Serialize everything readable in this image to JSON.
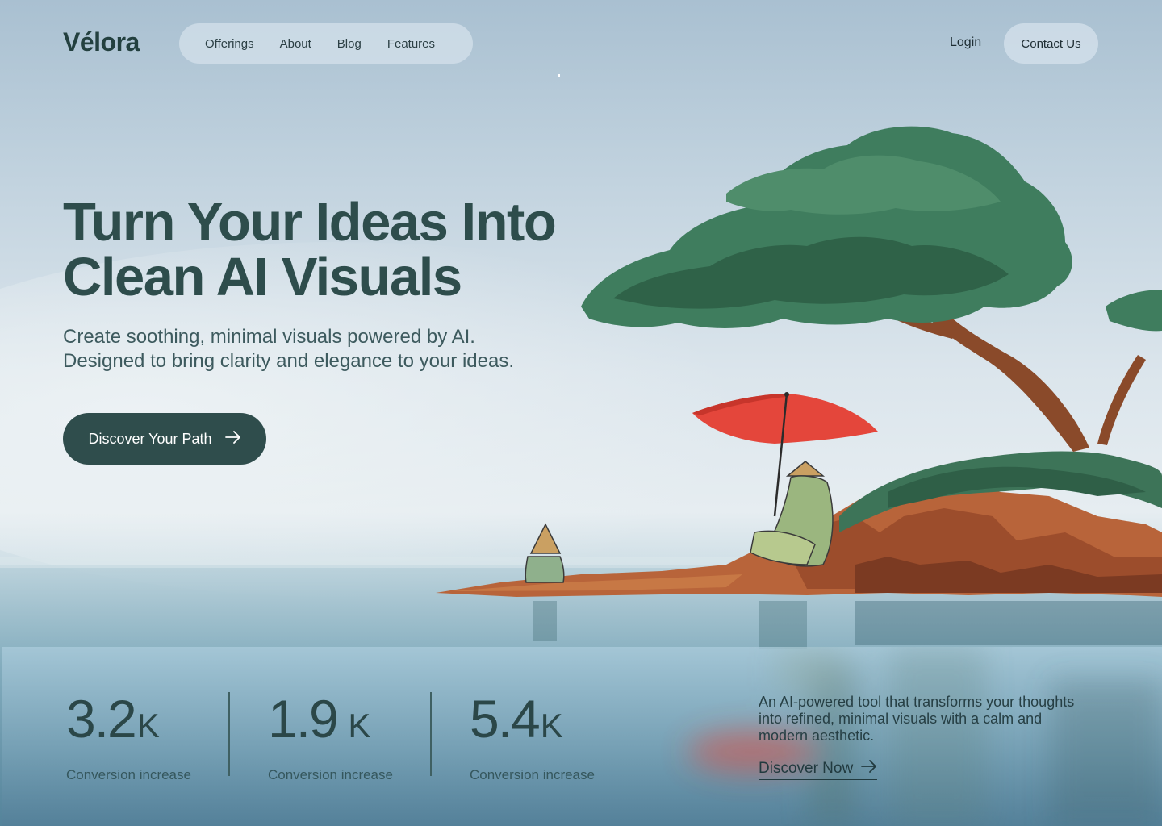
{
  "brand": {
    "logo": "Vélora"
  },
  "nav": {
    "items": [
      "Offerings",
      "About",
      "Blog",
      "Features"
    ],
    "login": "Login",
    "contact": "Contact Us"
  },
  "hero": {
    "title_lines": [
      "Turn Your Ideas Into",
      "Clean AI Visuals"
    ],
    "subtitle_lines": [
      "Create soothing, minimal visuals powered by AI.",
      "Designed to bring clarity and elegance to your ideas."
    ],
    "cta_label": "Discover Your Path",
    "cta_icon": "arrow-right-icon"
  },
  "stats": [
    {
      "value": "3.2",
      "unit": "K",
      "label": "Conversion increase"
    },
    {
      "value": "1.9",
      "unit": " K",
      "label": "Conversion increase"
    },
    {
      "value": "5.4",
      "unit": "K",
      "label": "Conversion increase"
    }
  ],
  "about": {
    "description_lines": [
      "An AI-powered tool that transforms your thoughts",
      "into refined, minimal visuals with a calm and",
      "modern aesthetic."
    ],
    "link_label": "Discover Now",
    "link_icon": "arrow-right-icon"
  },
  "colors": {
    "primary_dark": "#2f4d4c",
    "umbrella_red": "#e4463b",
    "tree_green": "#3f7d5e",
    "rock_orange": "#b8643a"
  }
}
